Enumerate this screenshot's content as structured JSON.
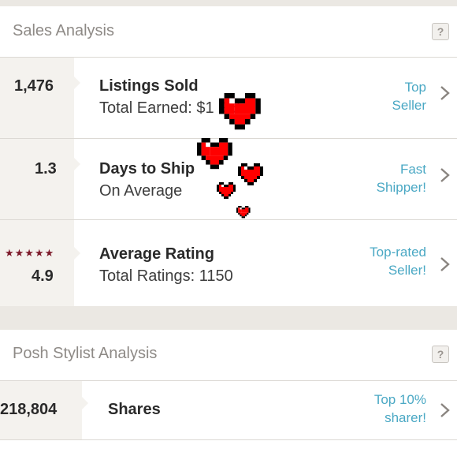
{
  "sales": {
    "title": "Sales Analysis",
    "help": "?",
    "rows": [
      {
        "number": "1,476",
        "label": "Listings Sold",
        "sub": "Total Earned: $1   9.67",
        "badge_line1": "Top",
        "badge_line2": "Seller"
      },
      {
        "number": "1.3",
        "label": "Days to Ship",
        "sub": "On Average",
        "badge_line1": "Fast",
        "badge_line2": "Shipper!"
      },
      {
        "number": "4.9",
        "stars": "★★★★★",
        "label": "Average Rating",
        "sub": "Total Ratings: 1150",
        "badge_line1": "Top-rated",
        "badge_line2": "Seller!"
      }
    ]
  },
  "stylist": {
    "title": "Posh Stylist Analysis",
    "help": "?",
    "rows": [
      {
        "number": "218,804",
        "label": "Shares",
        "badge_line1": "Top 10%",
        "badge_line2": "sharer!"
      }
    ]
  },
  "colors": {
    "accent_link": "#4aa8c4",
    "star": "#7d1a2a",
    "heart": "#ff0000",
    "page_bg": "#ebe8e3"
  },
  "icons": {
    "help": "question-mark-icon",
    "chevron": "chevron-right-icon",
    "sticker": "pixel-heart-icon"
  }
}
